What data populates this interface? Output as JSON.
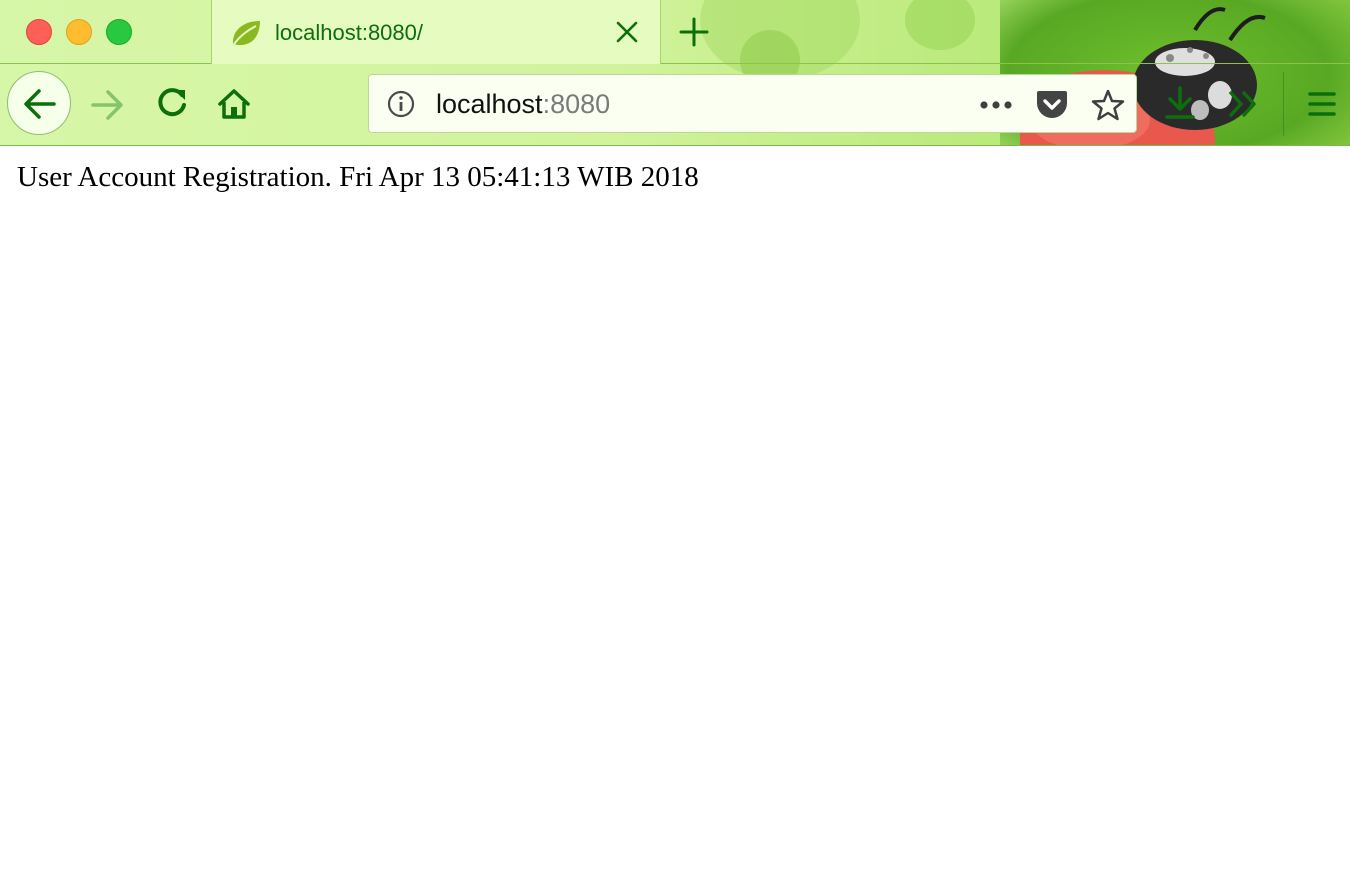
{
  "tab": {
    "title": "localhost:8080/",
    "favicon": "spring-leaf-icon"
  },
  "urlbar": {
    "host": "localhost",
    "port": ":8080"
  },
  "icons": {
    "back": "back-arrow-icon",
    "forward": "forward-arrow-icon",
    "reload": "reload-icon",
    "home": "home-icon",
    "info": "info-icon",
    "page_actions": "more-dots-icon",
    "pocket": "pocket-icon",
    "bookmark": "star-icon",
    "downloads": "download-icon",
    "overflow": "chevrons-icon",
    "menu": "hamburger-icon"
  },
  "colors": {
    "accent": "#0c6f0c",
    "theme_light": "#d7f7a8",
    "theme_dark": "#8fcf44"
  },
  "page": {
    "text": "User Account Registration. Fri Apr 13 05:41:13 WIB 2018"
  }
}
